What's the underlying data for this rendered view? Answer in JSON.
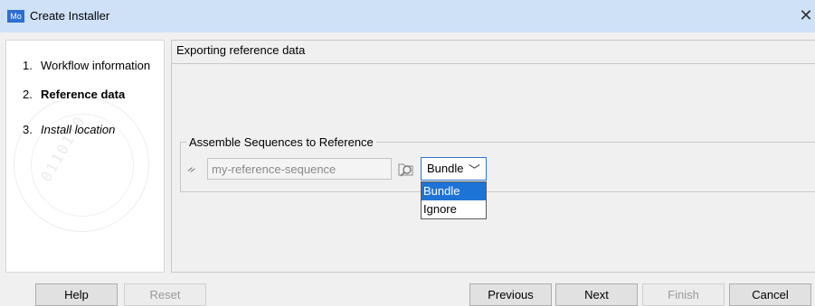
{
  "window": {
    "app_icon_text": "Mo",
    "title": "Create Installer",
    "close_glyph": "✕"
  },
  "steps": [
    {
      "num": "1.",
      "label": "Workflow information"
    },
    {
      "num": "2.",
      "label": "Reference data"
    },
    {
      "num": "3.",
      "label": "Install location"
    }
  ],
  "main": {
    "header": "Exporting reference data",
    "group_title": "Assemble Sequences to Reference",
    "sequence_icon": "sequence-icon",
    "sequence_value": "my-reference-sequence",
    "browse_icon": "browse-icon",
    "select_value": "Bundle",
    "select_options": [
      "Bundle",
      "Ignore"
    ],
    "selected_option": "Bundle"
  },
  "buttons": {
    "help": "Help",
    "reset": "Reset",
    "previous": "Previous",
    "next": "Next",
    "finish": "Finish",
    "cancel": "Cancel"
  },
  "colors": {
    "titlebar": "#cfe1f7",
    "accent": "#1e74d6",
    "select_border": "#2e75c9"
  }
}
